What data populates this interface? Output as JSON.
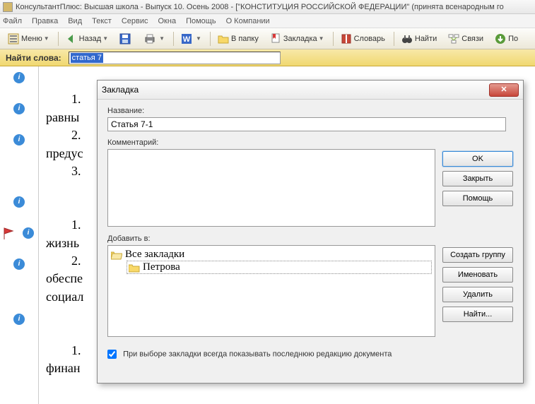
{
  "titlebar": "КонсультантПлюс: Высшая школа - Выпуск 10. Осень 2008 - [\"КОНСТИТУЦИЯ РОССИЙСКОЙ ФЕДЕРАЦИИ\" (принята всенародным го",
  "menubar": {
    "file": "Файл",
    "edit": "Правка",
    "view": "Вид",
    "text": "Текст",
    "service": "Сервис",
    "windows": "Окна",
    "help": "Помощь",
    "about": "О Компании"
  },
  "toolbar": {
    "menu": "Меню",
    "back": "Назад",
    "vpapku": "В папку",
    "zakladka": "Закладка",
    "slovar": "Словарь",
    "najti": "Найти",
    "svyazi": "Связи",
    "po": "По"
  },
  "findbar": {
    "label": "Найти слова:",
    "value": "статья 7"
  },
  "doc": {
    "l1": "1.",
    "l2": "равны",
    "l3": "2.",
    "l4": "предус",
    "l5": "3.",
    "l6": "1.",
    "l7": "жизнь",
    "l8": "2.",
    "l9": "обеспе",
    "l10": "социал",
    "l11": "1.",
    "l12": "финан"
  },
  "dialog": {
    "title": "Закладка",
    "name_label": "Название:",
    "name_value": "Статья 7-1",
    "comment_label": "Комментарий:",
    "addto_label": "Добавить в:",
    "tree_root": "Все закладки",
    "tree_child": "Петрова",
    "check_label": "При выборе закладки всегда показывать последнюю редакцию документа",
    "btn_ok": "OK",
    "btn_close": "Закрыть",
    "btn_help": "Помощь",
    "btn_group": "Создать группу",
    "btn_rename": "Именовать",
    "btn_delete": "Удалить",
    "btn_find": "Найти..."
  }
}
